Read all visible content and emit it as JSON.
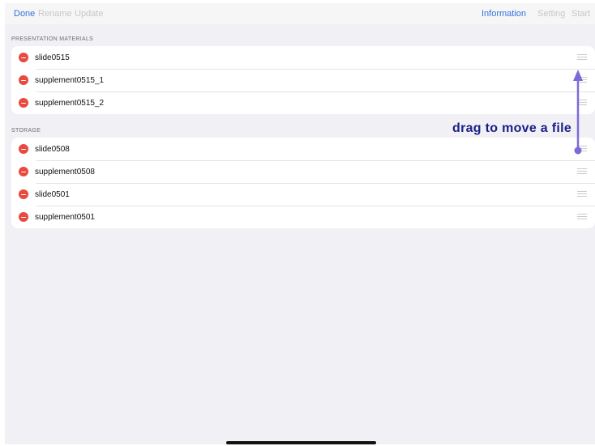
{
  "toolbar": {
    "done_label": "Done",
    "rename_label": "Rename",
    "update_label": "Update",
    "information_label": "Information",
    "setting_label": "Setting",
    "start_label": "Start"
  },
  "sections": [
    {
      "header": "PRESENTATION MATERIALS",
      "items": [
        {
          "label": "slide0515"
        },
        {
          "label": "supplement0515_1"
        },
        {
          "label": "supplement0515_2"
        }
      ]
    },
    {
      "header": "STORAGE",
      "items": [
        {
          "label": "slide0508"
        },
        {
          "label": "supplement0508"
        },
        {
          "label": "slide0501"
        },
        {
          "label": "supplement0501"
        }
      ]
    }
  ],
  "annotation": {
    "text": "drag to move a file"
  },
  "colors": {
    "accent": "#2f73d9",
    "delete": "#e9493e",
    "annotation": "#1a1f86",
    "arrow": "#7b6ad8",
    "background": "#f1f0f5"
  }
}
